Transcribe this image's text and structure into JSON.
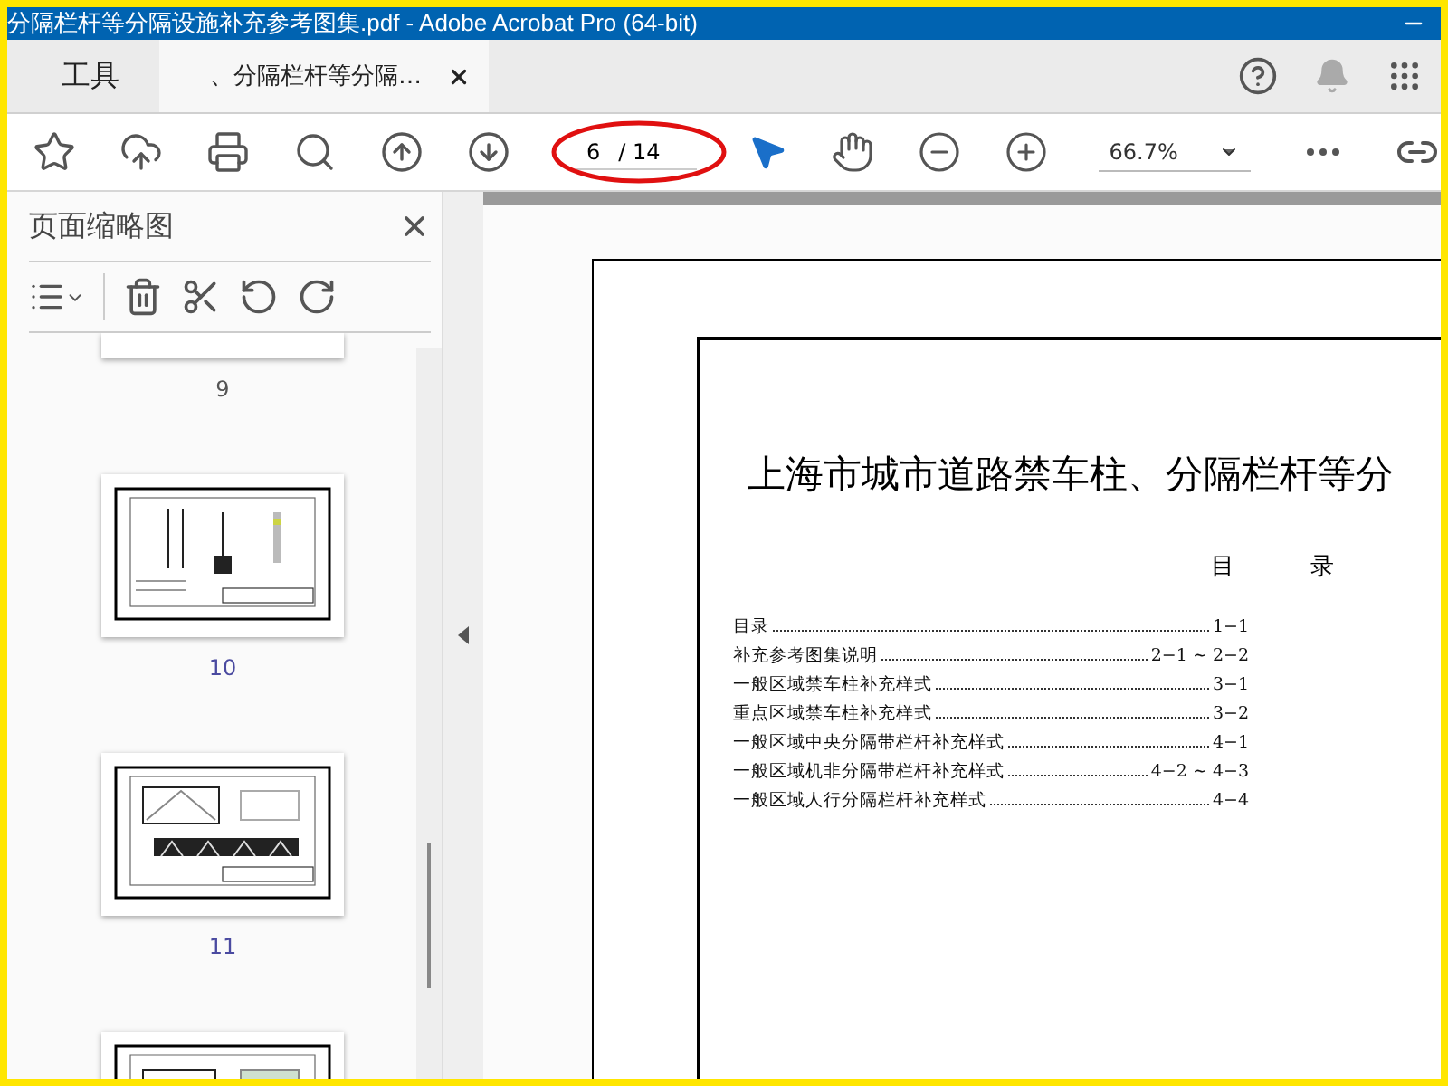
{
  "window": {
    "title": "分隔栏杆等分隔设施补充参考图集.pdf - Adobe Acrobat Pro (64-bit)"
  },
  "tabs": [
    {
      "label": "工具",
      "kind": "home",
      "selected": false
    },
    {
      "label": "、分隔栏杆等分隔…",
      "kind": "document",
      "selected": true
    }
  ],
  "toolbar": {
    "page_number": "6",
    "page_total": "/ 14",
    "zoom": "66.7%"
  },
  "sidebar": {
    "title": "页面缩略图",
    "thumbnails": [
      {
        "label": "9",
        "kind": "cut"
      },
      {
        "label": "10",
        "kind": "bollard"
      },
      {
        "label": "11",
        "kind": "fence"
      },
      {
        "kind": "partial"
      }
    ]
  },
  "document": {
    "title": "上海市城市道路禁车柱、分隔栏杆等分",
    "toc_heading": [
      "目",
      "录"
    ],
    "toc": [
      {
        "title": "目录",
        "page": "1−1"
      },
      {
        "title": "补充参考图集说明",
        "page": "2−1 ~ 2−2"
      },
      {
        "title": "一般区域禁车柱补充样式",
        "page": "3−1"
      },
      {
        "title": "重点区域禁车柱补充样式",
        "page": "3−2"
      },
      {
        "title": "一般区域中央分隔带栏杆补充样式",
        "page": "4−1"
      },
      {
        "title": "一般区域机非分隔带栏杆补充样式",
        "page": "4−2 ~ 4−3"
      },
      {
        "title": "一般区域人行分隔栏杆补充样式",
        "page": "4−4"
      }
    ]
  }
}
